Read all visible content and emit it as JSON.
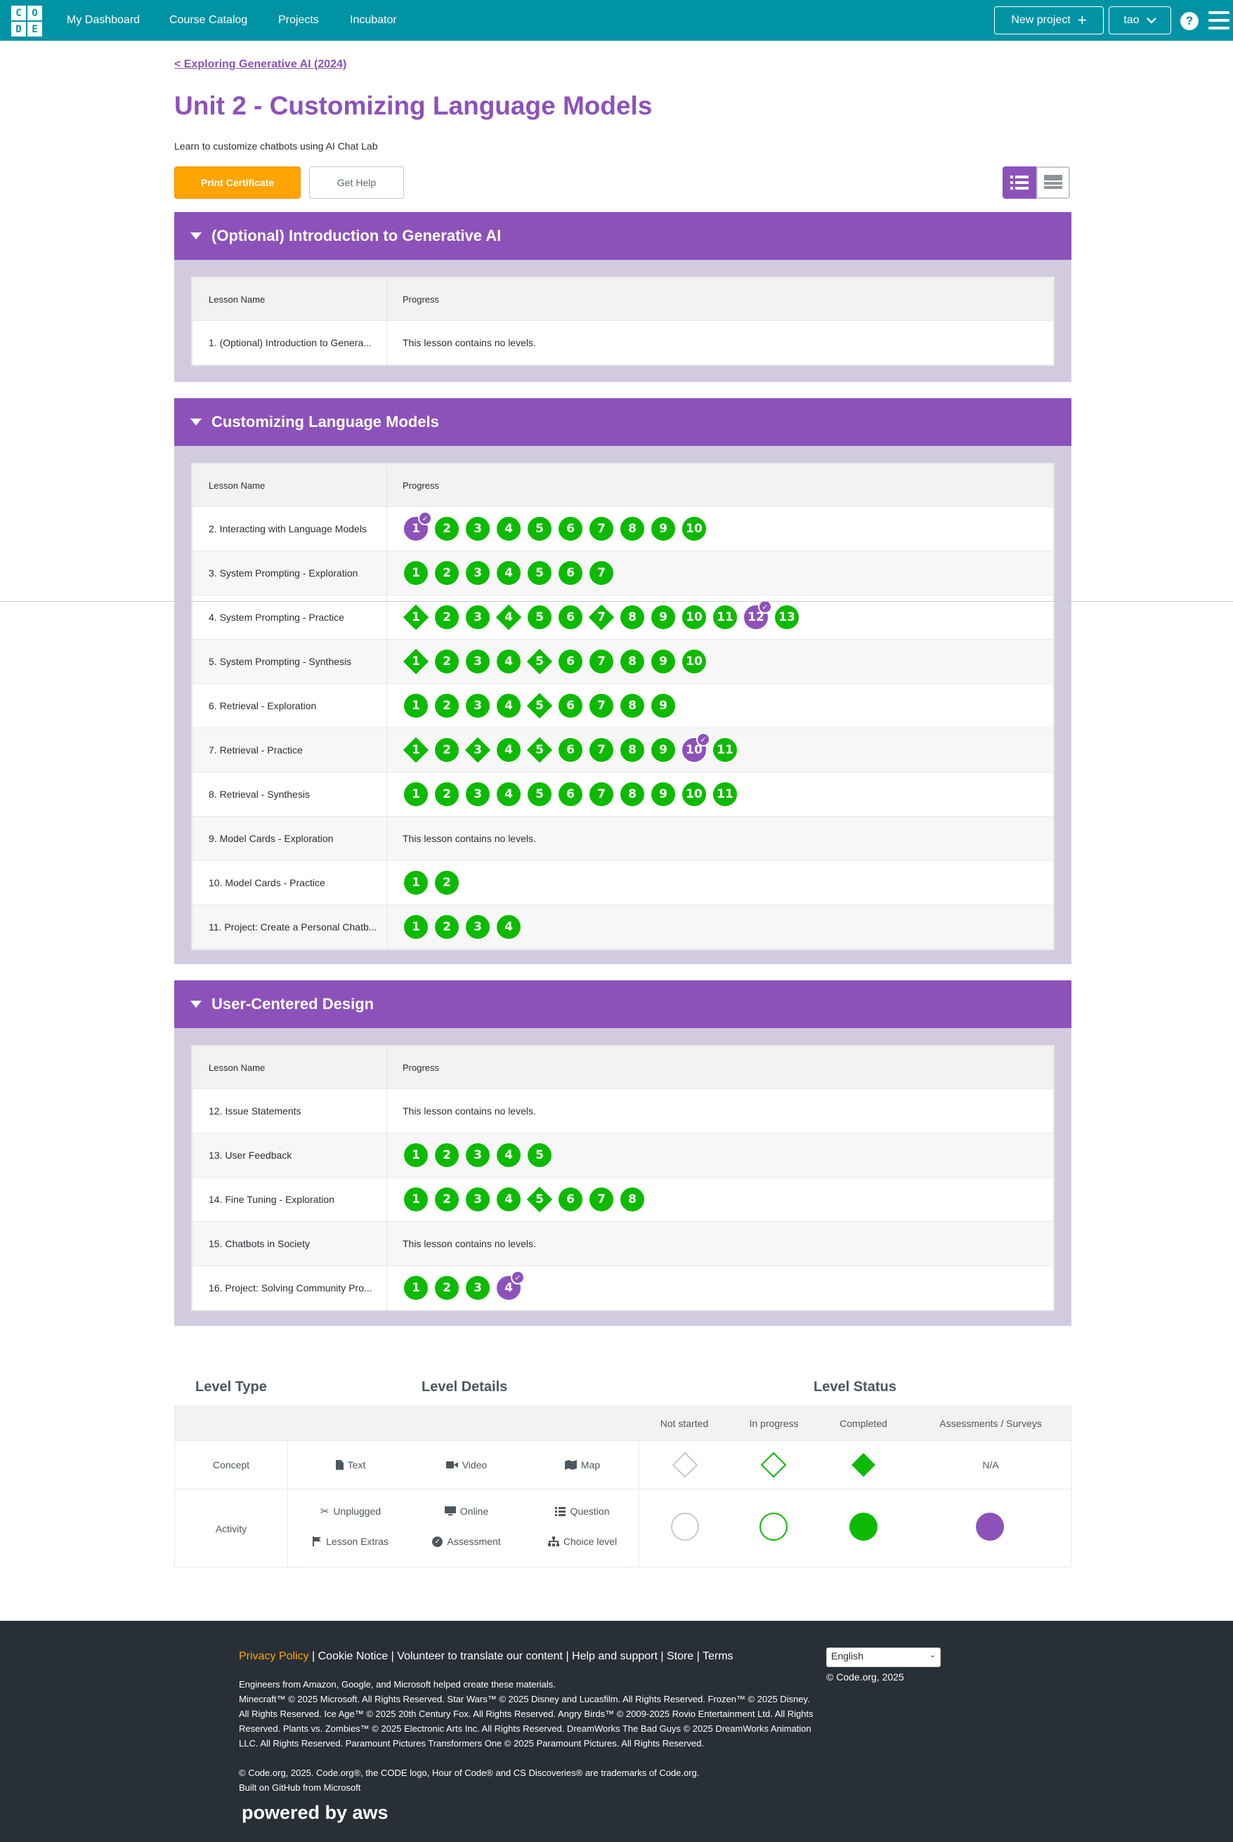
{
  "header": {
    "logo_letters": [
      "C",
      "O",
      "D",
      "E"
    ],
    "nav": [
      "My Dashboard",
      "Course Catalog",
      "Projects",
      "Incubator"
    ],
    "new_project": "New project",
    "user": "tao",
    "help": "?"
  },
  "breadcrumb": "< Exploring Generative AI (2024)",
  "title": "Unit 2 - Customizing Language Models",
  "description": "Learn to customize chatbots using AI Chat Lab",
  "buttons": {
    "print_certificate": "Print Certificate",
    "get_help": "Get Help"
  },
  "table_headers": {
    "lesson_name": "Lesson Name",
    "progress": "Progress"
  },
  "no_levels_text": "This lesson contains no levels.",
  "sections": [
    {
      "title": "(Optional) Introduction to Generative AI",
      "lessons": [
        {
          "name": "1. (Optional) Introduction to Genera...",
          "no_levels": true,
          "levels": []
        }
      ]
    },
    {
      "title": "Customizing Language Models",
      "lessons": [
        {
          "name": "2. Interacting with Language Models",
          "levels": [
            {
              "n": "1",
              "shape": "circle",
              "status": "purple",
              "check": true
            },
            {
              "n": "2"
            },
            {
              "n": "3"
            },
            {
              "n": "4"
            },
            {
              "n": "5"
            },
            {
              "n": "6"
            },
            {
              "n": "7"
            },
            {
              "n": "8"
            },
            {
              "n": "9"
            },
            {
              "n": "10"
            }
          ]
        },
        {
          "name": "3. System Prompting - Exploration",
          "levels": [
            {
              "n": "1"
            },
            {
              "n": "2"
            },
            {
              "n": "3"
            },
            {
              "n": "4"
            },
            {
              "n": "5"
            },
            {
              "n": "6"
            },
            {
              "n": "7"
            }
          ]
        },
        {
          "name": "4. System Prompting - Practice",
          "levels": [
            {
              "n": "1",
              "shape": "diamond"
            },
            {
              "n": "2"
            },
            {
              "n": "3"
            },
            {
              "n": "4",
              "shape": "diamond"
            },
            {
              "n": "5"
            },
            {
              "n": "6"
            },
            {
              "n": "7",
              "shape": "diamond"
            },
            {
              "n": "8"
            },
            {
              "n": "9"
            },
            {
              "n": "10"
            },
            {
              "n": "11"
            },
            {
              "n": "12",
              "status": "purple",
              "check": true
            },
            {
              "n": "13"
            }
          ]
        },
        {
          "name": "5. System Prompting - Synthesis",
          "levels": [
            {
              "n": "1",
              "shape": "diamond"
            },
            {
              "n": "2"
            },
            {
              "n": "3"
            },
            {
              "n": "4"
            },
            {
              "n": "5",
              "shape": "diamond"
            },
            {
              "n": "6"
            },
            {
              "n": "7"
            },
            {
              "n": "8"
            },
            {
              "n": "9"
            },
            {
              "n": "10"
            }
          ]
        },
        {
          "name": "6. Retrieval - Exploration",
          "levels": [
            {
              "n": "1"
            },
            {
              "n": "2"
            },
            {
              "n": "3"
            },
            {
              "n": "4"
            },
            {
              "n": "5",
              "shape": "diamond"
            },
            {
              "n": "6"
            },
            {
              "n": "7"
            },
            {
              "n": "8"
            },
            {
              "n": "9"
            }
          ]
        },
        {
          "name": "7. Retrieval - Practice",
          "levels": [
            {
              "n": "1",
              "shape": "diamond"
            },
            {
              "n": "2"
            },
            {
              "n": "3",
              "shape": "diamond"
            },
            {
              "n": "4"
            },
            {
              "n": "5",
              "shape": "diamond"
            },
            {
              "n": "6"
            },
            {
              "n": "7"
            },
            {
              "n": "8"
            },
            {
              "n": "9"
            },
            {
              "n": "10",
              "status": "purple",
              "check": true
            },
            {
              "n": "11"
            }
          ]
        },
        {
          "name": "8. Retrieval - Synthesis",
          "levels": [
            {
              "n": "1"
            },
            {
              "n": "2"
            },
            {
              "n": "3"
            },
            {
              "n": "4"
            },
            {
              "n": "5"
            },
            {
              "n": "6"
            },
            {
              "n": "7"
            },
            {
              "n": "8"
            },
            {
              "n": "9"
            },
            {
              "n": "10"
            },
            {
              "n": "11"
            }
          ]
        },
        {
          "name": "9. Model Cards - Exploration",
          "no_levels": true,
          "levels": []
        },
        {
          "name": "10. Model Cards - Practice",
          "levels": [
            {
              "n": "1"
            },
            {
              "n": "2"
            }
          ]
        },
        {
          "name": "11. Project: Create a Personal Chatb...",
          "levels": [
            {
              "n": "1"
            },
            {
              "n": "2"
            },
            {
              "n": "3"
            },
            {
              "n": "4"
            }
          ]
        }
      ]
    },
    {
      "title": "User-Centered Design",
      "lessons": [
        {
          "name": "12. Issue Statements",
          "no_levels": true,
          "levels": []
        },
        {
          "name": "13. User Feedback",
          "levels": [
            {
              "n": "1"
            },
            {
              "n": "2"
            },
            {
              "n": "3"
            },
            {
              "n": "4"
            },
            {
              "n": "5"
            }
          ]
        },
        {
          "name": "14. Fine Tuning - Exploration",
          "levels": [
            {
              "n": "1"
            },
            {
              "n": "2"
            },
            {
              "n": "3"
            },
            {
              "n": "4"
            },
            {
              "n": "5",
              "shape": "diamond"
            },
            {
              "n": "6"
            },
            {
              "n": "7"
            },
            {
              "n": "8"
            }
          ]
        },
        {
          "name": "15. Chatbots in Society",
          "no_levels": true,
          "levels": []
        },
        {
          "name": "16. Project: Solving Community Pro...",
          "levels": [
            {
              "n": "1"
            },
            {
              "n": "2"
            },
            {
              "n": "3"
            },
            {
              "n": "4",
              "status": "purple",
              "check": true
            }
          ]
        }
      ]
    }
  ],
  "key": {
    "level_type": "Level Type",
    "level_details": "Level Details",
    "level_status": "Level Status",
    "statuses": [
      "Not started",
      "In progress",
      "Completed",
      "Assessments / Surveys"
    ],
    "concept": "Concept",
    "activity": "Activity",
    "concept_details": [
      "Text",
      "Video",
      "Map"
    ],
    "activity_details": [
      "Unplugged",
      "Online",
      "Question",
      "Lesson Extras",
      "Assessment",
      "Choice level"
    ],
    "na": "N/A"
  },
  "footer": {
    "links": [
      "Privacy Policy",
      "Cookie Notice",
      "Volunteer to translate our content",
      "Help and support",
      "Store",
      "Terms"
    ],
    "line1": "Engineers from Amazon, Google, and Microsoft helped create these materials.",
    "line2": "Minecraft™ © 2025 Microsoft. All Rights Reserved. Star Wars™ © 2025 Disney and Lucasfilm. All Rights Reserved. Frozen™ © 2025 Disney. All Rights Reserved. Ice Age™ © 2025 20th Century Fox. All Rights Reserved. Angry Birds™ © 2009-2025 Rovio Entertainment Ltd. All Rights Reserved. Plants vs. Zombies™ © 2025 Electronic Arts Inc. All Rights Reserved. DreamWorks The Bad Guys © 2025 DreamWorks Animation LLC. All Rights Reserved. Paramount Pictures Transformers One © 2025 Paramount Pictures. All Rights Reserved.",
    "line3": "© Code.org, 2025. Code.org®, the CODE logo, Hour of Code® and CS Discoveries® are trademarks of Code.org.",
    "line4": "Built on GitHub from Microsoft",
    "language": "English",
    "copyright": "© Code.org, 2025",
    "powered": "powered by aws"
  },
  "colors": {
    "teal": "#0093a4",
    "purple": "#8c52ba",
    "green": "#0eba00",
    "orange": "#ffa400"
  }
}
